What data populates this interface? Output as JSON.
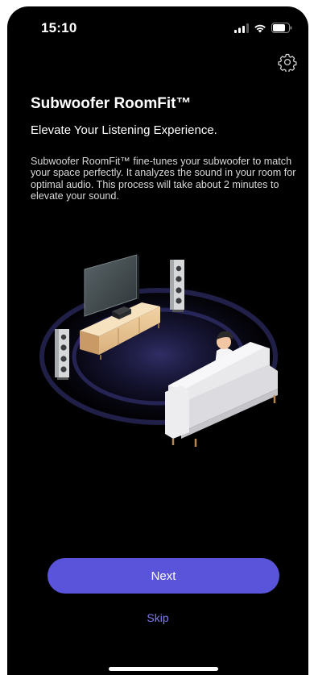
{
  "status_bar": {
    "time": "15:10",
    "icons": [
      "cellular-signal-icon",
      "wifi-icon",
      "battery-icon"
    ]
  },
  "header": {
    "settings_icon": "gear-icon"
  },
  "content": {
    "title": "Subwoofer RoomFit™",
    "subtitle": "Elevate Your Listening Experience.",
    "description": "Subwoofer RoomFit™ fine-tunes your subwoofer to match your space perfectly. It analyzes the sound in your room for optimal audio. This process will take about 2 minutes to elevate your sound."
  },
  "actions": {
    "next_label": "Next",
    "skip_label": "Skip"
  },
  "colors": {
    "background": "#000000",
    "accent": "#5954d9",
    "skip_text": "#7d7af0"
  }
}
